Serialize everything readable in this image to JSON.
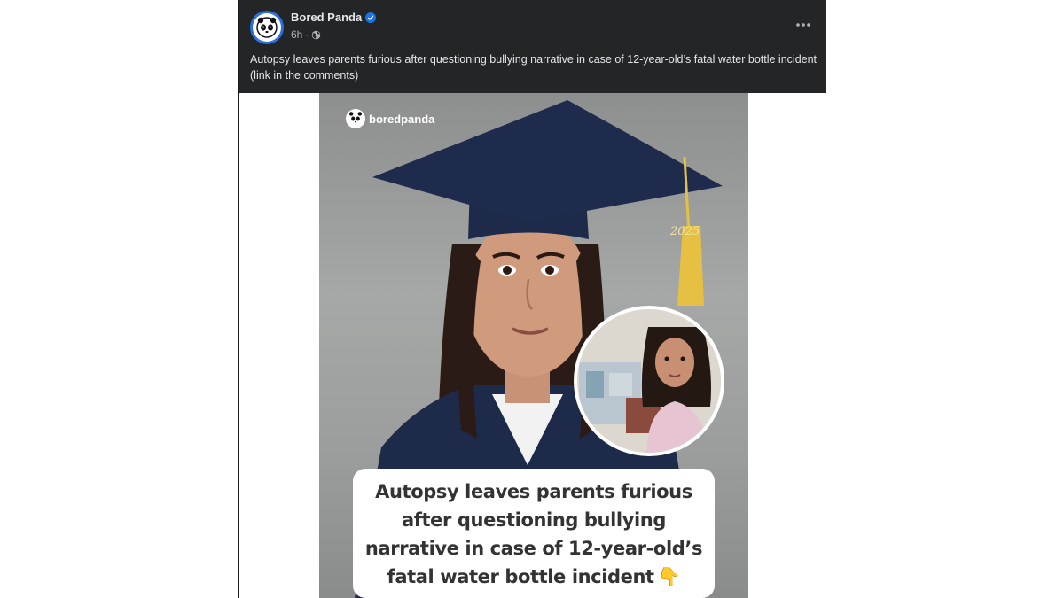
{
  "post": {
    "page_name": "Bored Panda",
    "timestamp": "6h",
    "separator": "·",
    "caption": "Autopsy leaves parents furious after questioning bullying narrative in case of 12-year-old’s fatal water bottle incident (link in the comments)"
  },
  "image": {
    "watermark": "boredpanda",
    "tassel_year": "2025",
    "headline_lines": [
      "Autopsy leaves parents furious",
      "after questioning bullying",
      "narrative in case of 12-year-old’s",
      "fatal water bottle incident"
    ],
    "headline_emoji": "👇"
  },
  "icons": {
    "avatar": "panda-logo-icon",
    "verified": "verified-badge-icon",
    "audience": "globe-icon",
    "more": "more-options-icon"
  },
  "colors": {
    "header_bg": "#242526",
    "text_primary": "#e4e6eb",
    "text_secondary": "#b0b3b8",
    "verified_blue": "#1b74e4",
    "gown_navy": "#1d2a4a",
    "tassel_gold": "#e5c043"
  }
}
